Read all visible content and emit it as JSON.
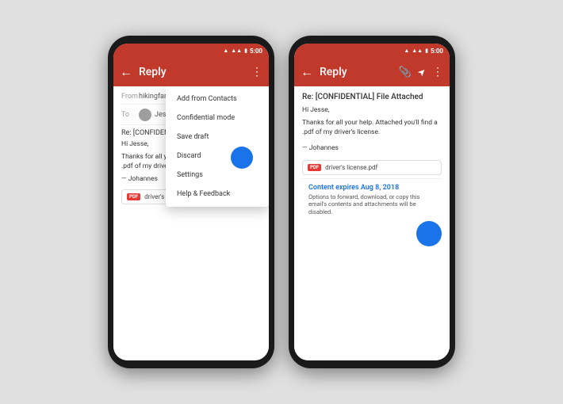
{
  "phone1": {
    "statusBar": {
      "time": "5:00",
      "signals": "▲▲▲ ▮"
    },
    "appBar": {
      "backLabel": "←",
      "title": "Reply",
      "menuIcon": "⋮"
    },
    "email": {
      "fromLabel": "From",
      "fromValue": "hikingfan@gma...",
      "toLabel": "To",
      "toName": "Jesse Slit...",
      "subject": "Re: [CONFIDENTIAL] Fil...",
      "greeting": "Hi Jesse,",
      "body": "Thanks for all your help. Attached you'll find a .pdf of my driver's license.",
      "signature": "— Johannes",
      "attachment": "driver's license.pdf",
      "attachmentType": "PDF"
    },
    "dropdown": {
      "items": [
        "Add from Contacts",
        "Confidential mode",
        "Save draft",
        "Discard",
        "Settings",
        "Help & Feedback"
      ],
      "highlightedIndex": 1
    }
  },
  "phone2": {
    "statusBar": {
      "time": "5:00",
      "signals": "▲▲▲ ▮"
    },
    "appBar": {
      "backLabel": "←",
      "title": "Reply",
      "attachIcon": "📎",
      "sendIcon": "▶",
      "menuIcon": "⋮"
    },
    "email": {
      "subject": "Re: [CONFIDENTIAL] File Attached",
      "greeting": "Hi Jesse,",
      "body": "Thanks for all your help. Attached you'll find a .pdf of my driver's license.",
      "signature": "— Johannes",
      "attachment": "driver's license.pdf",
      "attachmentType": "PDF"
    },
    "confidentialBanner": {
      "title": "Content expires Aug 8, 2018",
      "text": "Options to forward, download, or copy this email's contents and attachments will be disabled."
    }
  }
}
